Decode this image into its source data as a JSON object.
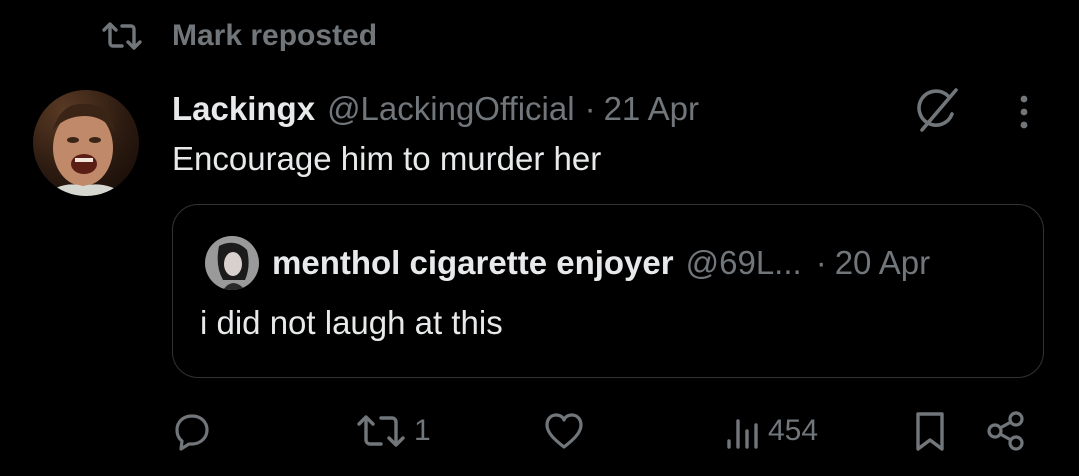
{
  "repost": {
    "label": "Mark reposted"
  },
  "tweet": {
    "author_name": "Lackingx",
    "author_handle": "@LackingOfficial",
    "separator": "·",
    "date": "21 Apr",
    "text": "Encourage him to murder her"
  },
  "quoted_tweet": {
    "author_name": "menthol cigarette enjoyer",
    "author_handle": "@69L...",
    "separator": "·",
    "date": "20 Apr",
    "text": "i did not laugh at this"
  },
  "actions": {
    "replies": "",
    "reposts": "1",
    "likes": "",
    "views": "454"
  },
  "icons": {
    "repost_header": "repost-icon",
    "grok": "grok-icon",
    "more": "more-icon",
    "reply": "reply-icon",
    "repost": "repost-icon",
    "like": "heart-icon",
    "views": "views-icon",
    "bookmark": "bookmark-icon",
    "share": "share-icon"
  },
  "colors": {
    "background": "#000000",
    "primary_text": "#e7e9ea",
    "secondary_text": "#71767b",
    "border": "#2f3336"
  }
}
